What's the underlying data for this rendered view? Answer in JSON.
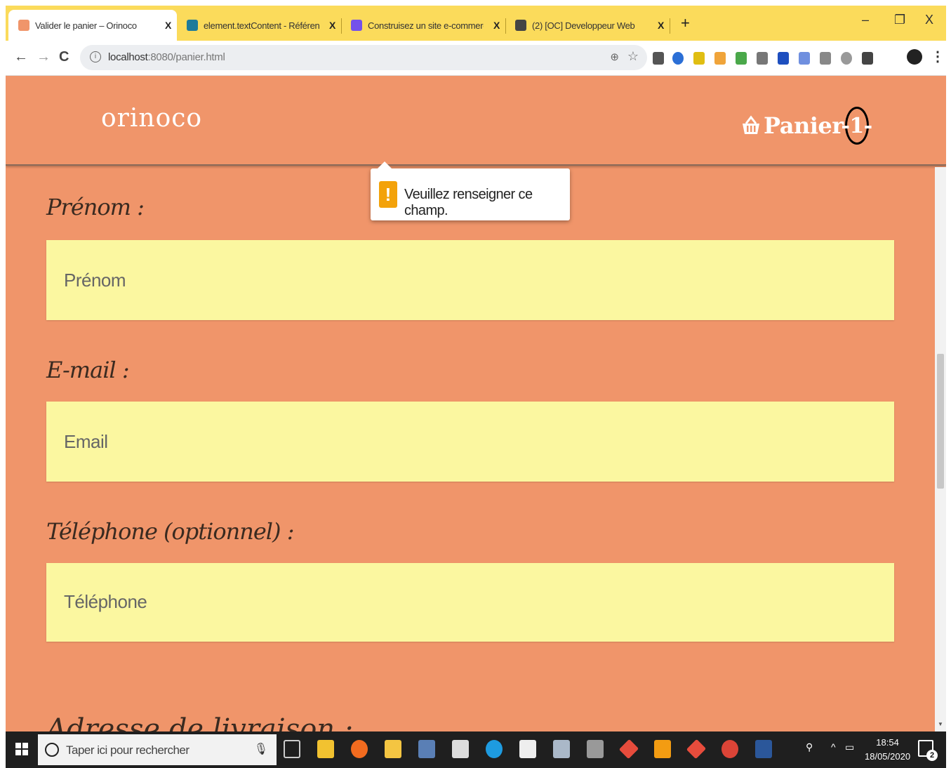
{
  "browser": {
    "tabs": [
      {
        "title": "Valider le panier – Orinoco",
        "close": "X",
        "favicon_color": "#f0956a",
        "active": true
      },
      {
        "title": "element.textContent - Référence",
        "close": "X",
        "favicon_color": "#1d7a9a"
      },
      {
        "title": "Construisez un site e-commerce",
        "close": "X",
        "favicon_color": "#7451eb"
      },
      {
        "title": "(2) [OC] Developpeur Web",
        "close": "X",
        "favicon_color": "#444444"
      }
    ],
    "new_tab": "+",
    "window_controls": {
      "minimize": "–",
      "restore": "❐",
      "close": "X"
    },
    "nav": {
      "back": "←",
      "forward": "→",
      "reload": "C"
    },
    "url_host": "localhost",
    "url_rest": ":8080/panier.html",
    "zoom_icon": "⊕",
    "star_icon": "☆",
    "kebab": "⋮"
  },
  "header": {
    "brand": "orinoco",
    "cart_label": "Panier",
    "cart_count": "-1-"
  },
  "tooltip": {
    "icon": "!",
    "message": "Veuillez renseigner ce champ."
  },
  "form": {
    "fields": [
      {
        "label": "Prénom :",
        "placeholder": "Prénom"
      },
      {
        "label": "E-mail :",
        "placeholder": "Email"
      },
      {
        "label": "Téléphone (optionnel) :",
        "placeholder": "Téléphone"
      }
    ],
    "cutoff_label": "Adresse de livraison :"
  },
  "taskbar": {
    "search_placeholder": "Taper ici pour rechercher",
    "time": "18:54",
    "date": "18/05/2020",
    "notifications": "2"
  },
  "colors": {
    "accent_yellow": "#fbdb5b",
    "page_bg": "#f0956a",
    "input_bg": "#fbf7a0",
    "warning": "#f3a20a"
  }
}
